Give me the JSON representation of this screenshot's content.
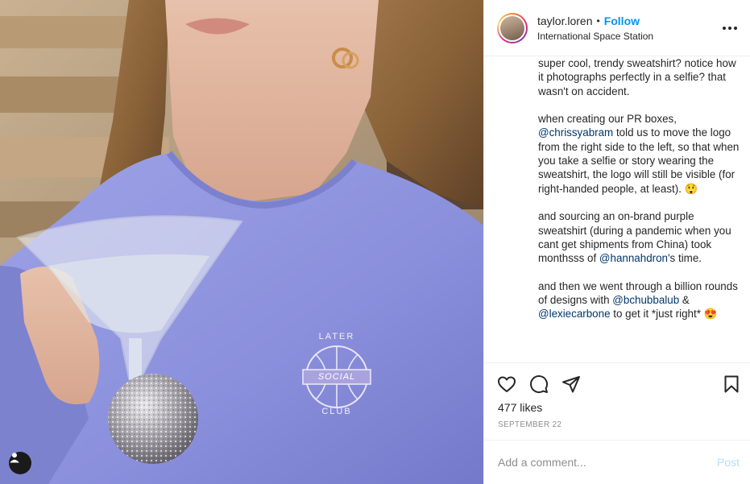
{
  "post": {
    "username": "taylor.loren",
    "separator": "•",
    "follow_label": "Follow",
    "location": "International Space Station",
    "more_icon": "more-horizontal-icon"
  },
  "photo": {
    "sweatshirt_logo_lines": [
      "LATER",
      "SOCIAL",
      "CLUB"
    ],
    "user_tag_icon": "person-icon"
  },
  "caption": {
    "p1": "super cool, trendy sweatshirt? notice how it photographs perfectly in a selfie? that wasn't on accident.",
    "p2_a": "when creating our PR boxes, ",
    "p2_mention": "@chrissyabram",
    "p2_b": " told us to move the logo from the right side to the left, so that when you take a selfie or story wearing the sweatshirt, the logo will still be visible (for right-handed people, at least). 😲",
    "p3_a": "and sourcing an on-brand purple sweatshirt (during a pandemic when you cant get shipments from China) took monthsss of ",
    "p3_mention": "@hannahdron",
    "p3_b": "'s time.",
    "p4_a": "and then we went through a billion rounds of designs with ",
    "p4_mention1": "@bchubbalub",
    "p4_mid": " & ",
    "p4_mention2": "@lexiecarbone",
    "p4_b": " to get it *just right* 😍"
  },
  "actions": {
    "icons": [
      "heart-icon",
      "comment-icon",
      "share-icon",
      "bookmark-icon"
    ],
    "likes": "477 likes",
    "date": "SEPTEMBER 22"
  },
  "comment": {
    "placeholder": "Add a comment...",
    "post_label": "Post"
  },
  "colors": {
    "follow": "#0095f6",
    "mention": "#00376b",
    "post_disabled": "#b2dffc",
    "sweatshirt": "#8e92dd"
  }
}
